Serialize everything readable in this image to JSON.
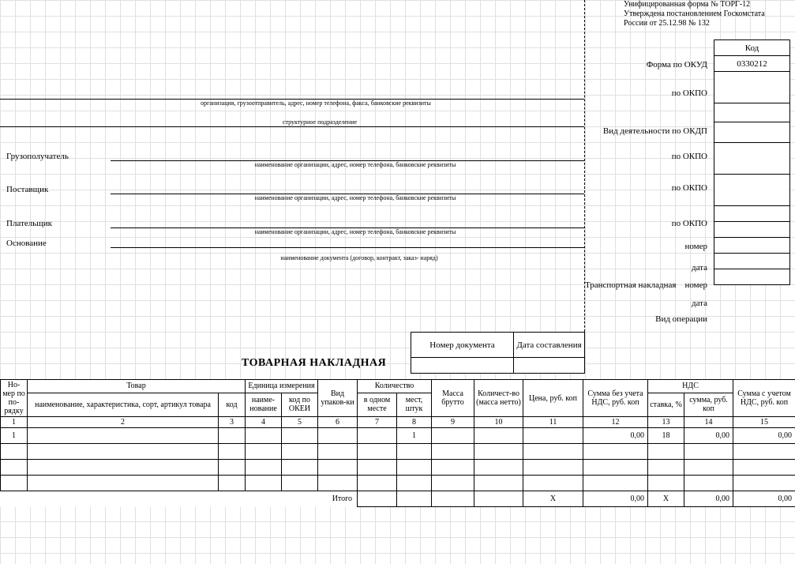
{
  "header": {
    "form_note_line1": "Унифицированная форма № ТОРГ-12",
    "form_note_line2": "Утверждена постановлением Госкомстата",
    "form_note_line3": "России от 25.12.98  № 132"
  },
  "code_box": {
    "kod_label": "Код",
    "okud_label": "Форма по ОКУД",
    "okud_value": "0330212",
    "okpo1_label": "по ОКПО",
    "okpo1_value": "",
    "okdp_label": "Вид деятельности по ОКДП",
    "okdp_value": "",
    "okpo2_label": "по ОКПО",
    "okpo2_value": "",
    "okpo3_label": "по ОКПО",
    "okpo3_value": "",
    "okpo4_label": "по ОКПО",
    "okpo4_value": "",
    "num_label": "номер",
    "num_value": "",
    "date_label": "дата",
    "date_value": "",
    "trans_label": "Транспортная накладная",
    "trans_num_label": "номер",
    "trans_num_value": "",
    "trans_date_label": "дата",
    "trans_date_value": "",
    "oper_label": "Вид операции",
    "oper_value": ""
  },
  "parties": {
    "sender_caption": "организация, грузоотправитель, адрес, номер телефона, факса, банковские реквизиты",
    "struct_caption": "структурное подразделение",
    "consignee_label": "Грузополучатель",
    "consignee_caption": "наименование организации, адрес, номер телефона, банковские реквизиты",
    "supplier_label": "Поставщик",
    "supplier_caption": "наименование организации, адрес, номер телефона, банковские реквизиты",
    "payer_label": "Плательщик",
    "payer_caption": "наименование организации, адрес, номер телефона, банковские реквизиты",
    "basis_label": "Основание",
    "basis_caption": "наименование документа (договор, контракт, заказ- наряд)"
  },
  "doc": {
    "title": "ТОВАРНАЯ НАКЛАДНАЯ",
    "doc_num_label": "Номер документа",
    "doc_date_label": "Дата составления",
    "doc_num_value": "",
    "doc_date_value": ""
  },
  "table": {
    "headers": {
      "no": "Но-мер по по-рядку",
      "goods": "Товар",
      "goods_name": "наименование, характеристика, сорт, артикул товара",
      "goods_code": "код",
      "unit": "Единица измерения",
      "unit_name": "наиме-нование",
      "unit_code": "код по ОКЕИ",
      "pack": "Вид упаков-ки",
      "qty": "Количество",
      "qty_one": "в одном месте",
      "qty_places": "мест, штук",
      "gross": "Масса брутто",
      "net": "Количест-во (масса нетто)",
      "price": "Цена, руб. коп",
      "sum_no_vat": "Сумма без учета НДС, руб. коп",
      "vat": "НДС",
      "vat_rate": "ставка, %",
      "vat_sum": "сумма, руб. коп",
      "sum_vat": "Сумма с учетом НДС, руб. коп"
    },
    "col_nums": [
      "1",
      "2",
      "3",
      "4",
      "5",
      "6",
      "7",
      "8",
      "9",
      "10",
      "11",
      "12",
      "13",
      "14",
      "15"
    ],
    "rows": [
      {
        "no": "1",
        "name": "",
        "code": "",
        "unit_name": "",
        "unit_code": "",
        "pack": "",
        "qty_one": "",
        "qty_places": "1",
        "gross": "",
        "net": "",
        "price": "",
        "sum_no_vat": "0,00",
        "vat_rate": "18",
        "vat_sum": "0,00",
        "sum_vat": "0,00"
      },
      {
        "no": "",
        "name": "",
        "code": "",
        "unit_name": "",
        "unit_code": "",
        "pack": "",
        "qty_one": "",
        "qty_places": "",
        "gross": "",
        "net": "",
        "price": "",
        "sum_no_vat": "",
        "vat_rate": "",
        "vat_sum": "",
        "sum_vat": ""
      },
      {
        "no": "",
        "name": "",
        "code": "",
        "unit_name": "",
        "unit_code": "",
        "pack": "",
        "qty_one": "",
        "qty_places": "",
        "gross": "",
        "net": "",
        "price": "",
        "sum_no_vat": "",
        "vat_rate": "",
        "vat_sum": "",
        "sum_vat": ""
      },
      {
        "no": "",
        "name": "",
        "code": "",
        "unit_name": "",
        "unit_code": "",
        "pack": "",
        "qty_one": "",
        "qty_places": "",
        "gross": "",
        "net": "",
        "price": "",
        "sum_no_vat": "",
        "vat_rate": "",
        "vat_sum": "",
        "sum_vat": ""
      }
    ],
    "totals": {
      "label": "Итого",
      "qty_one": "",
      "qty_places": "",
      "gross": "",
      "net": "",
      "price_x": "Х",
      "sum_no_vat": "0,00",
      "vat_rate_x": "Х",
      "vat_sum": "0,00",
      "sum_vat": "0,00"
    }
  }
}
